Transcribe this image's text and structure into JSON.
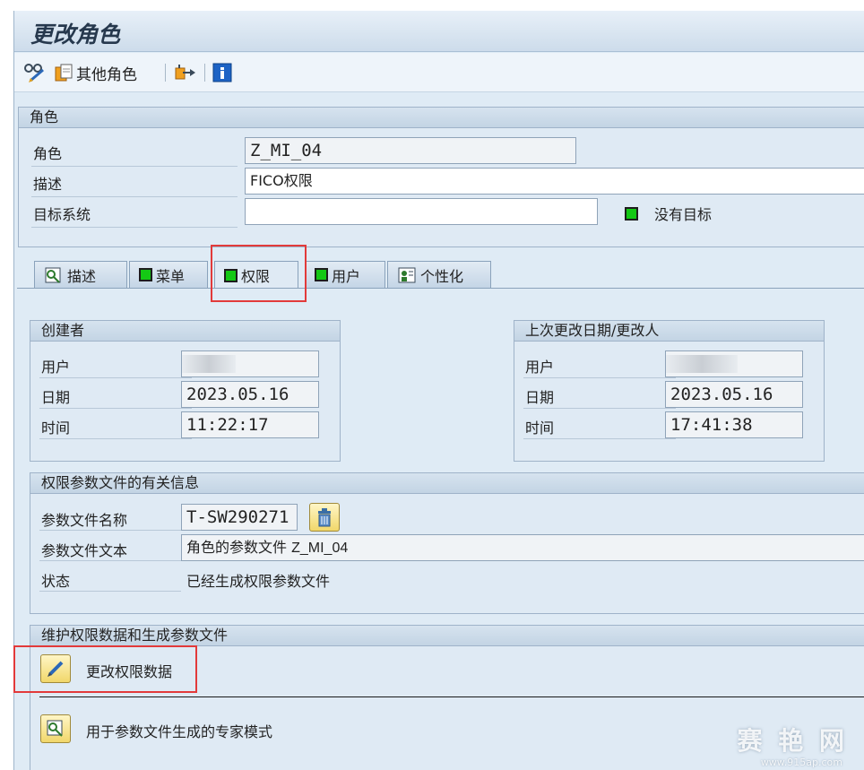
{
  "window": {
    "title": "更改角色"
  },
  "toolbar": {
    "other_role_label": "其他角色"
  },
  "role_group": {
    "header": "角色",
    "role_label": "角色",
    "role_value": "Z_MI_04",
    "desc_label": "描述",
    "desc_value": "FICO权限",
    "target_label": "目标系统",
    "target_value": "",
    "no_target_label": "没有目标",
    "status_color": "#14c814"
  },
  "tabs": [
    {
      "label": "描述",
      "icon": "glasses-icon"
    },
    {
      "label": "菜单",
      "icon": "green-status-icon"
    },
    {
      "label": "权限",
      "icon": "green-status-icon",
      "active": true
    },
    {
      "label": "用户",
      "icon": "green-status-icon"
    },
    {
      "label": "个性化",
      "icon": "personalization-icon"
    }
  ],
  "creator": {
    "header": "创建者",
    "user_label": "用户",
    "user_value": "",
    "date_label": "日期",
    "date_value": "2023.05.16",
    "time_label": "时间",
    "time_value": "11:22:17"
  },
  "last_change": {
    "header": "上次更改日期/更改人",
    "user_label": "用户",
    "user_value": "",
    "date_label": "日期",
    "date_value": "2023.05.16",
    "time_label": "时间",
    "time_value": "17:41:38"
  },
  "profile_info": {
    "header": "权限参数文件的有关信息",
    "name_label": "参数文件名称",
    "name_value": "T-SW290271",
    "text_label": "参数文件文本",
    "text_prefix": "角色的参数文件 ",
    "text_role": "Z_MI_04",
    "status_label": "状态",
    "status_value": "已经生成权限参数文件"
  },
  "maintain": {
    "header": "维护权限数据和生成参数文件",
    "change_auth_label": "更改权限数据",
    "expert_mode_label": "用于参数文件生成的专家模式"
  },
  "watermark": {
    "text": "赛 艳 网",
    "url": "www.915ap.com"
  },
  "highlight_color": "#e23a3a"
}
